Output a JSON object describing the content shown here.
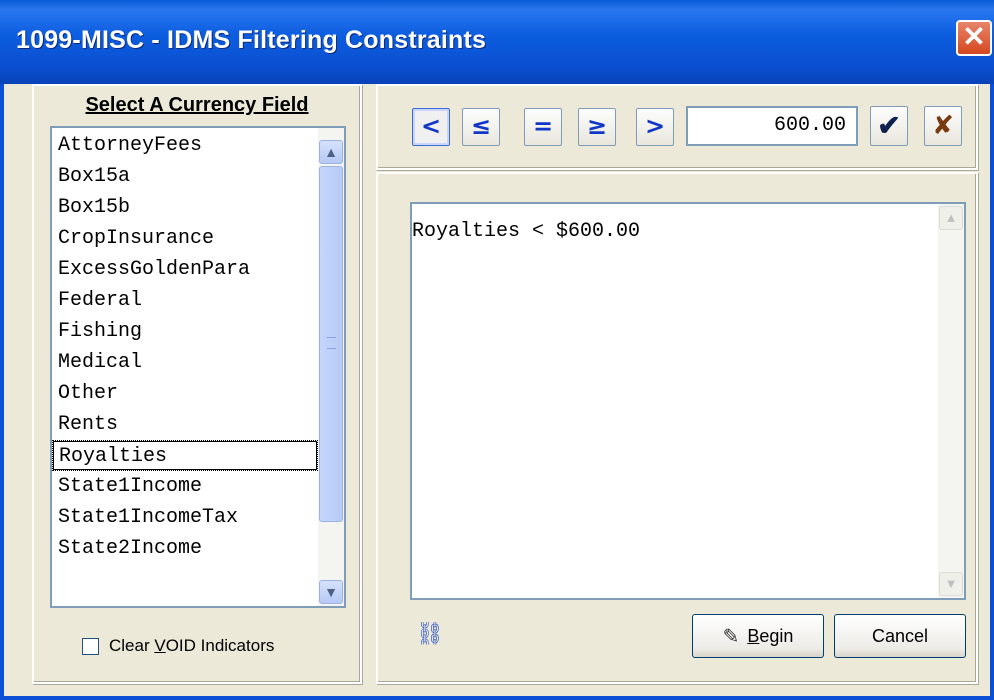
{
  "window": {
    "title": "1099-MISC - IDMS Filtering Constraints",
    "close_glyph": "✕"
  },
  "left_panel": {
    "heading": "Select A Currency Field",
    "fields": [
      "AttorneyFees",
      "Box15a",
      "Box15b",
      "CropInsurance",
      "ExcessGoldenPara",
      "Federal",
      "Fishing",
      "Medical",
      "Other",
      "Rents",
      "Royalties",
      "State1Income",
      "State1IncomeTax",
      "State2Income"
    ],
    "selected_field": "Royalties",
    "checkbox": {
      "label_before": "Clear ",
      "label_mnemonic": "V",
      "label_after": "OID Indicators",
      "checked": false
    }
  },
  "operators": {
    "less_than": "<",
    "less_equal": "≤",
    "equal": "=",
    "greater_equal": "≥",
    "greater_than": ">",
    "active": "less_than"
  },
  "value_input": {
    "value": "600.00"
  },
  "confirm_glyph": "✔",
  "clear_glyph": "✘",
  "expression": {
    "text": "Royalties < $600.00"
  },
  "buttons": {
    "begin_mnemonic": "B",
    "begin_rest": "egin",
    "cancel": "Cancel",
    "begin_icon": "pencil-check-icon",
    "link_icon": "link-icon",
    "link_glyph": "⛓"
  },
  "colors": {
    "title_bar": "#0a4fd6",
    "operator_blue": "#1037c8",
    "face": "#ece9d8"
  }
}
